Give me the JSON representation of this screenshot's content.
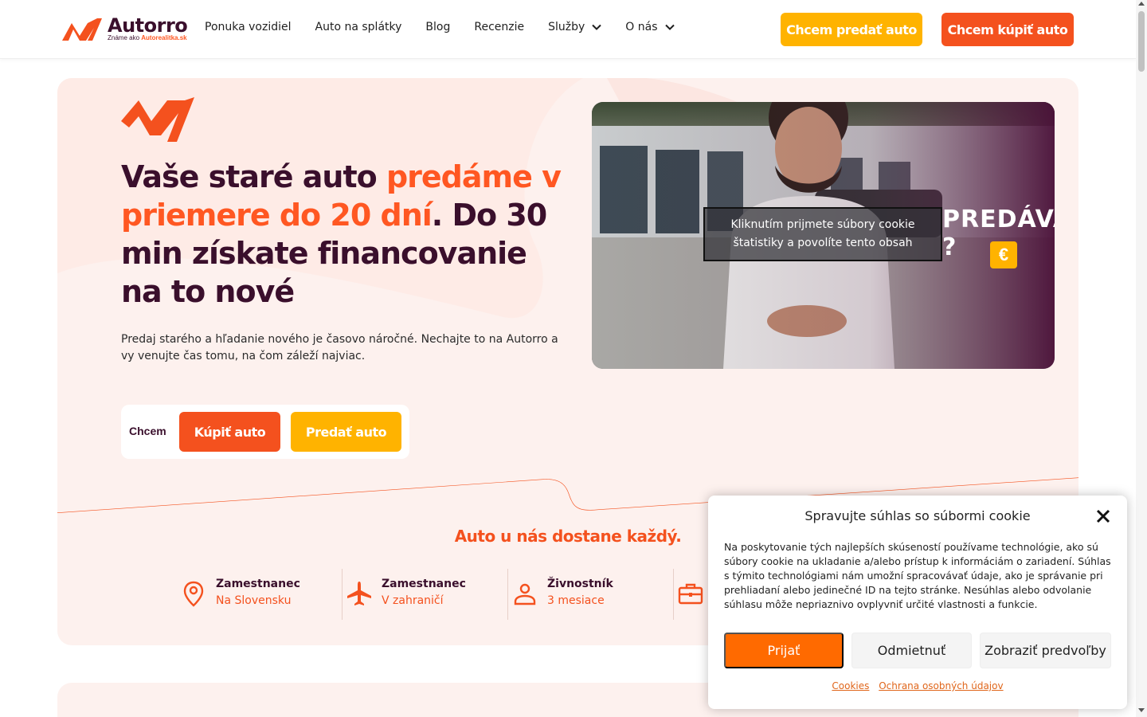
{
  "header": {
    "logo": {
      "brand": "Autorro",
      "tagline_prefix": "Známe ako",
      "tagline_highlight": "Autorealitka.sk"
    },
    "nav": [
      {
        "label": "Ponuka vozidiel"
      },
      {
        "label": "Auto na splátky"
      },
      {
        "label": "Blog"
      },
      {
        "label": "Recenzie"
      },
      {
        "label": "Služby",
        "dropdown": true
      },
      {
        "label": "O nás",
        "dropdown": true
      }
    ],
    "sell_button": "Chcem predať auto",
    "buy_button": "Chcem kúpiť auto"
  },
  "hero": {
    "headline_part1": "Vaše staré auto ",
    "headline_accent": "predáme v priemere do 20 dní",
    "headline_part2": ". Do 30 min získate financovanie na to nové",
    "subtext": "Predaj starého a hľadanie nového je časovo náročné. Nechajte to na Autorro a vy venujte čas tomu, na čom záleží najviac.",
    "cta_label": "Chcem",
    "cta_buy": "Kúpiť auto",
    "cta_sell": "Predať auto"
  },
  "video": {
    "overlay_text": "Kliknutím prijmete súbory cookie štatistiky a povolíte tento obsah",
    "title_text": "PREDÁVATE ?",
    "badge": "€"
  },
  "features_section": {
    "title": "Auto u nás dostane každý.",
    "items": [
      {
        "title": "Zamestnanec",
        "subtitle": "Na Slovensku",
        "icon": "location-pin-icon"
      },
      {
        "title": "Zamestnanec",
        "subtitle": "V zahraničí",
        "icon": "airplane-icon"
      },
      {
        "title": "Živnostník",
        "subtitle": "3 mesiace",
        "icon": "person-icon"
      },
      {
        "title": "",
        "subtitle": "",
        "icon": "briefcase-icon"
      }
    ]
  },
  "cookie_dialog": {
    "title": "Spravujte súhlas so súbormi cookie",
    "text": "Na poskytovanie tých najlepších skúseností používame technológie, ako sú súbory cookie na ukladanie a/alebo prístup k informáciám o zariadení. Súhlas s týmito technológiami nám umožní spracovávať údaje, ako je správanie pri prehliadaní alebo jedinečné ID na tejto stránke. Nesúhlas alebo odvolanie súhlasu môže nepriaznivo ovplyvniť určité vlastnosti a funkcie.",
    "accept": "Prijať",
    "deny": "Odmietnuť",
    "preferences": "Zobraziť predvoľby",
    "links": [
      "Cookies",
      "Ochrana osobných údajov"
    ]
  },
  "colors": {
    "brand_orange": "#f4511e",
    "brand_yellow": "#ffb300",
    "brand_dark": "#3a0f2c",
    "hero_bg": "#fdf1ee",
    "accept_orange": "#ff6a00"
  }
}
